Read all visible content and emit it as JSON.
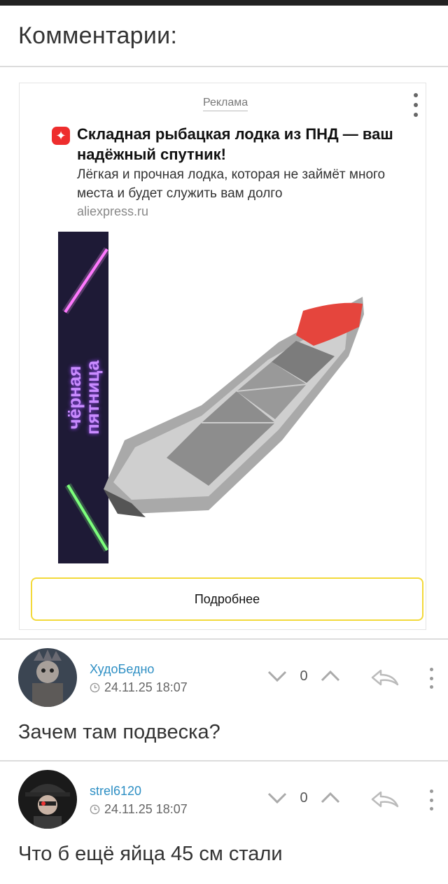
{
  "page": {
    "title": "Комментарии:"
  },
  "ad": {
    "label": "Реклама",
    "title": "Складная рыбацкая лодка из ПНД — ваш надёжный спутник!",
    "description": "Лёгкая и прочная лодка, которая не займёт много места и будет служить вам долго",
    "domain": "aliexpress.ru",
    "banner_text_line1": "чёрная",
    "banner_text_line2": "пятница",
    "button_label": "Подробнее",
    "icons": {
      "brand": "aliexpress-logo-icon",
      "menu": "more-vertical-icon"
    },
    "colors": {
      "button_border": "#f3d93a",
      "logo": "#ee2d2d",
      "boat_accent": "#e5453d"
    }
  },
  "comments": [
    {
      "author": "ХудоБедно",
      "timestamp": "24.11.25 18:07",
      "votes": "0",
      "text": "Зачем там подвеска?"
    },
    {
      "author": "strel6120",
      "timestamp": "24.11.25 18:07",
      "votes": "0",
      "text": "Что б ещё яйца 45 см стали"
    }
  ],
  "comment_icons": [
    "clock-icon",
    "downvote-chevron-icon",
    "upvote-chevron-icon",
    "reply-arrow-icon",
    "more-vertical-icon"
  ],
  "colors": {
    "author_link": "#2e8fc4",
    "divider": "#dcdcdc"
  }
}
